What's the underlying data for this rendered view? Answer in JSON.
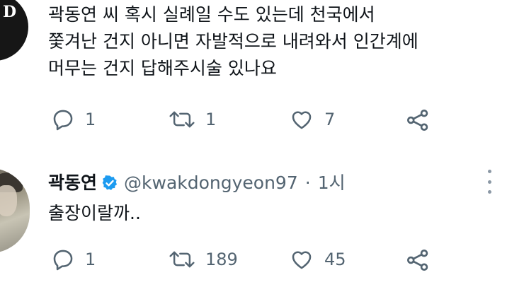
{
  "tweets": [
    {
      "text_lines": [
        "곽동연 씨 혹시 실례일 수도 있는데 천국에서",
        "쫓겨난 건지 아니면 자발적으로 내려와서 인간계에",
        "머무는 건지 답해주시술 있나요"
      ],
      "avatar_text": "D",
      "avatar_icon": "avatar-dark",
      "actions": {
        "reply": {
          "icon": "reply-icon",
          "count": "1"
        },
        "retweet": {
          "icon": "retweet-icon",
          "count": "1"
        },
        "like": {
          "icon": "heart-icon",
          "count": "7"
        },
        "share": {
          "icon": "share-icon"
        }
      }
    },
    {
      "author_name": "곽동연",
      "handle": "@kwakdongyeon97",
      "separator": "·",
      "time": "1시",
      "text": "출장이랄까..",
      "avatar_icon": "avatar-photo",
      "actions": {
        "reply": {
          "icon": "reply-icon",
          "count": "1"
        },
        "retweet": {
          "icon": "retweet-icon",
          "count": "189"
        },
        "like": {
          "icon": "heart-icon",
          "count": "45"
        },
        "share": {
          "icon": "share-icon"
        }
      }
    }
  ],
  "colors": {
    "text": "#0f1419",
    "muted": "#536471",
    "verified": "#1d9bf0",
    "background": "#ffffff"
  }
}
